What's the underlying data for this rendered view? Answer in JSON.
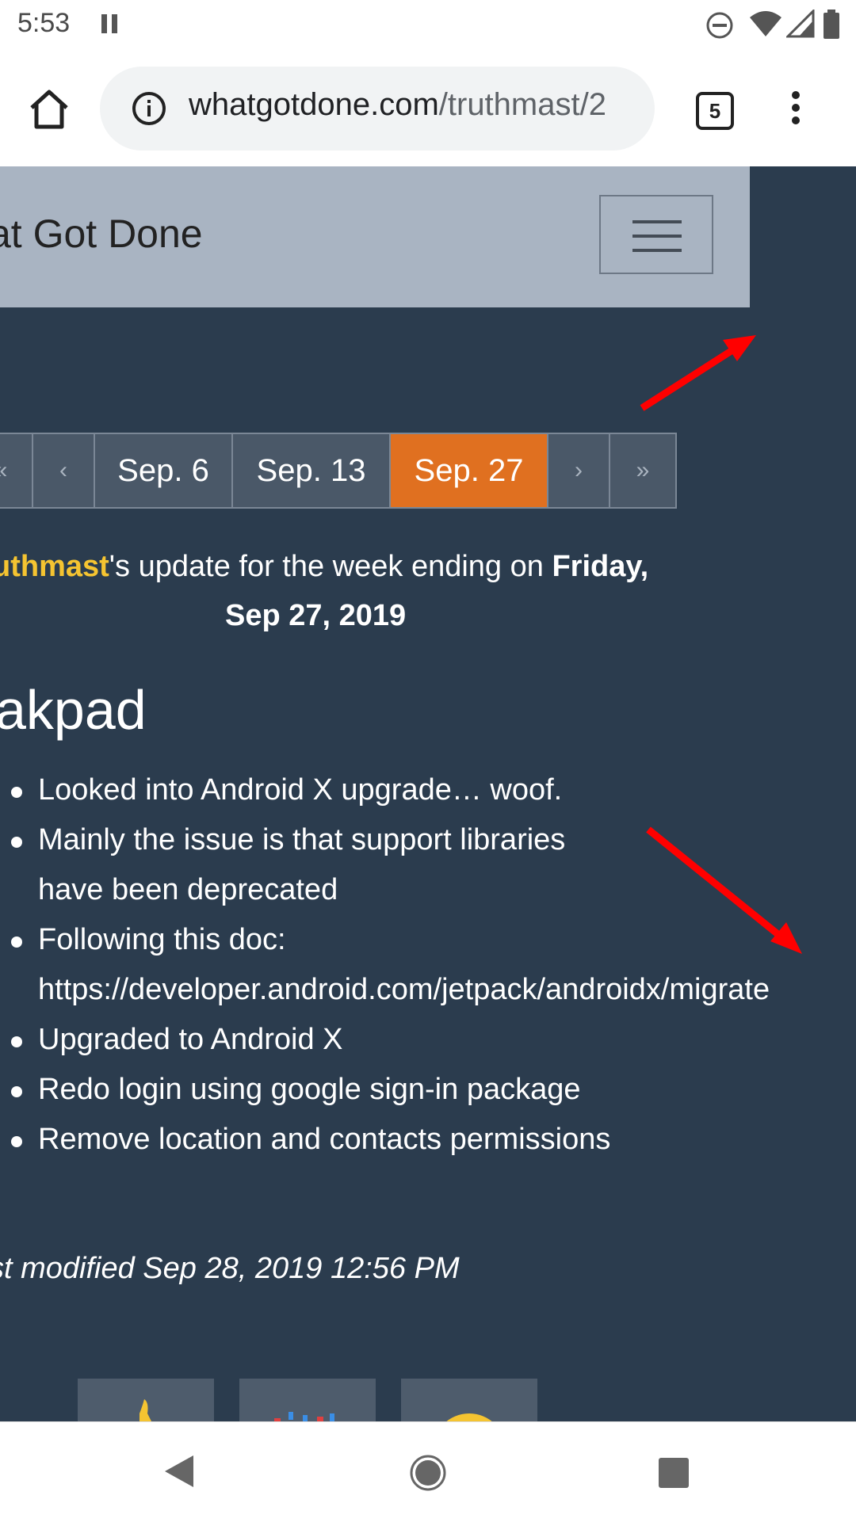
{
  "status_bar": {
    "time": "5:53",
    "icons": [
      "pause-icon",
      "do-not-disturb-icon",
      "wifi-icon",
      "signal-icon",
      "battery-icon"
    ]
  },
  "browser": {
    "url_domain": "whatgotdone.com",
    "url_path": "/truthmast/2",
    "tab_count": "5"
  },
  "header": {
    "site_title": "at Got Done"
  },
  "pagination": {
    "items": [
      "«",
      "‹",
      "Sep. 6",
      "Sep. 13",
      "Sep. 27",
      "›",
      "»"
    ],
    "active": "Sep. 27"
  },
  "update": {
    "username": "uthmast",
    "text_middle": "'s update for the week ending on ",
    "day": "Friday,",
    "date": "Sep 27, 2019"
  },
  "project": {
    "title": "akpad",
    "items": [
      "Looked into Android X upgrade… woof.",
      "Mainly the issue is that support libraries",
      "have been deprecated",
      "Following this doc:",
      "https://developer.android.com/jetpack/androidx/migrate",
      "Upgraded to Android X",
      "Redo login using google sign-in package",
      "Remove location and contacts permissions"
    ]
  },
  "footer": {
    "last_modified": "st modified Sep 28, 2019 12:56 PM"
  },
  "colors": {
    "page_bg": "#2b3c4e",
    "header_bg": "#a9b4c2",
    "active_page": "#e07020",
    "username": "#f5c431",
    "annotation_arrow": "#ff0000"
  }
}
